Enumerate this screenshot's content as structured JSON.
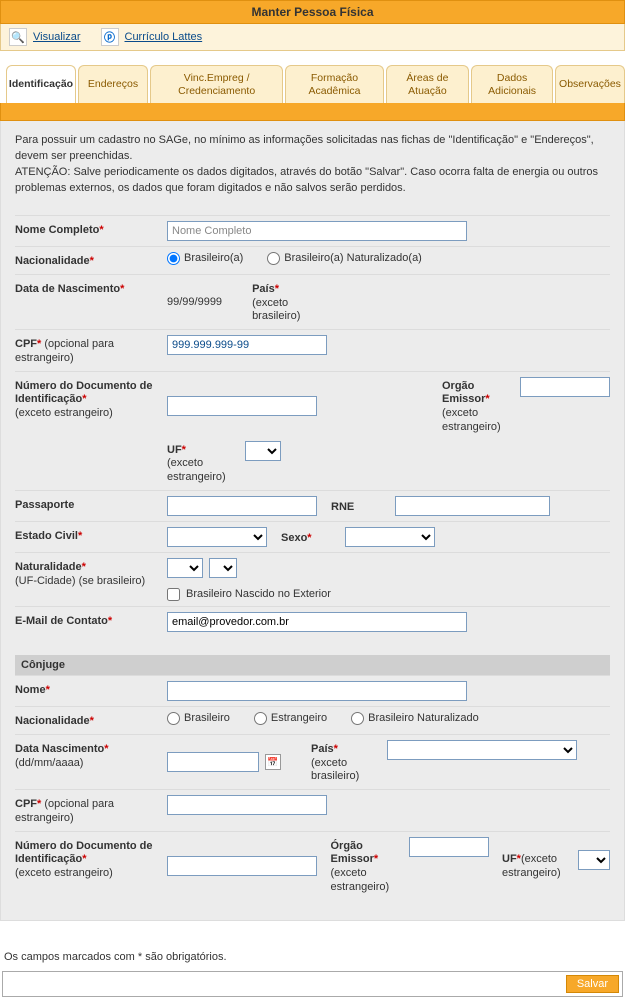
{
  "title": "Manter Pessoa Física",
  "toolbar": {
    "visualizar": "Visualizar",
    "lattes": "Currículo Lattes"
  },
  "tabs": {
    "identificacao": "Identificação",
    "enderecos": "Endereços",
    "vinc": "Vinc.Empreg / Credenciamento",
    "formacao": "Formação Acadêmica",
    "atuacao": "Áreas de Atuação",
    "dados": "Dados Adicionais",
    "obs": "Observações"
  },
  "intro_line1": "Para possuir um cadastro no SAGe, no mínimo as informações solicitadas nas fichas de \"Identificação\" e \"Endereços\", devem ser preenchidas.",
  "intro_line2": "ATENÇÃO: Salve periodicamente os dados digitados, através do botão \"Salvar\". Caso ocorra falta de energia ou outros problemas externos, os dados que foram digitados e não salvos serão perdidos.",
  "labels": {
    "nome_completo": "Nome Completo",
    "nacionalidade": "Nacionalidade",
    "data_nasc": "Data de Nascimento",
    "pais": "País",
    "pais_sub": "(exceto brasileiro)",
    "cpf": "CPF",
    "cpf_sub": " (opcional para estrangeiro)",
    "numdoc": "Número do Documento de Identificação",
    "numdoc_sub": "(exceto estrangeiro)",
    "orgao": "Orgão Emissor",
    "orgao2": "Órgão Emissor",
    "orgao_sub": "(exceto estrangeiro)",
    "uf": "UF",
    "uf_sub": "(exceto estrangeiro)",
    "passaporte": "Passaporte",
    "rne": "RNE",
    "estado_civil": "Estado Civil",
    "sexo": "Sexo",
    "naturalidade": "Naturalidade",
    "naturalidade_sub": "(UF-Cidade) (se brasileiro)",
    "nascido_ext": "Brasileiro Nascido no Exterior",
    "email": "E-Mail de Contato",
    "conjuge": "Cônjuge",
    "nome": "Nome",
    "data_nasc2": "Data Nascimento",
    "data_nasc2_sub": "(dd/mm/aaaa)"
  },
  "radio": {
    "brasileiro": "Brasileiro(a)",
    "brasileiro_nat": "Brasileiro(a) Naturalizado(a)",
    "c_brasileiro": "Brasileiro",
    "c_estrangeiro": "Estrangeiro",
    "c_bras_nat": "Brasileiro Naturalizado"
  },
  "values": {
    "nome_completo_ph": "Nome Completo",
    "data_nasc": "99/99/9999",
    "cpf_ph": "999.999.999-99",
    "email_ph": "email@provedor.com.br"
  },
  "footnote": "Os campos marcados com * são obrigatórios.",
  "save_btn": "Salvar"
}
